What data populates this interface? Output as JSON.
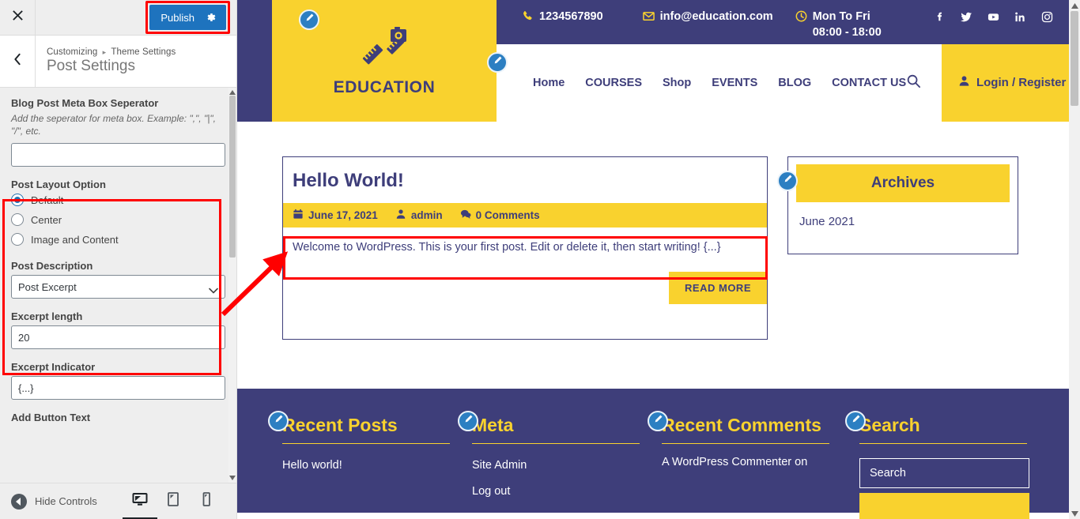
{
  "customizer": {
    "close_label": "Close",
    "publish_label": "Publish",
    "breadcrumb_root": "Customizing",
    "breadcrumb_sep": "▸",
    "breadcrumb_parent": "Theme Settings",
    "panel_title": "Post Settings",
    "hide_controls_label": "Hide Controls",
    "accent_blue": "#1E73BE",
    "highlight_red": "#ff0000",
    "controls": [
      {
        "type": "text",
        "label": "Blog Post Meta Box Seperator",
        "description": "Add the seperator for meta box. Example: \",\", \"|\", \"/\", etc.",
        "value": ""
      },
      {
        "type": "radio",
        "label": "Post Layout Option",
        "options": [
          {
            "label": "Default",
            "selected": true
          },
          {
            "label": "Center",
            "selected": false
          },
          {
            "label": "Image and Content",
            "selected": false
          }
        ]
      },
      {
        "type": "select",
        "label": "Post Description",
        "value": "Post Excerpt"
      },
      {
        "type": "text",
        "label": "Excerpt length",
        "value": "20"
      },
      {
        "type": "text",
        "label": "Excerpt Indicator",
        "value": "{...}"
      },
      {
        "type": "cutoff",
        "label": "Add Button Text"
      }
    ],
    "devices": [
      {
        "name": "desktop",
        "active": true
      },
      {
        "name": "tablet",
        "active": false
      },
      {
        "name": "mobile",
        "active": false
      }
    ]
  },
  "site": {
    "colors": {
      "navy": "#3E3E7A",
      "yellow": "#F9D22E"
    },
    "topbar": {
      "phone": "1234567890",
      "email": "info@education.com",
      "hours": "Mon To Fri 08:00 - 18:00",
      "socials": [
        "facebook",
        "twitter",
        "youtube",
        "linkedin",
        "instagram"
      ]
    },
    "logo_text": "EDUCATION",
    "nav": [
      "Home",
      "COURSES",
      "Shop",
      "EVENTS",
      "BLOG",
      "CONTACT US"
    ],
    "login_label": "Login / Register",
    "post": {
      "title": "Hello World!",
      "date": "June 17, 2021",
      "author": "admin",
      "comments": "0 Comments",
      "excerpt": "Welcome to WordPress. This is your first post. Edit or delete it, then start writing!",
      "excerpt_indicator": "{...}",
      "read_more": "READ MORE"
    },
    "archives_widget": {
      "title": "Archives",
      "items": [
        "June 2021"
      ]
    },
    "footer_widgets": [
      {
        "title": "Recent Posts",
        "items": [
          "Hello world!"
        ]
      },
      {
        "title": "Meta",
        "items": [
          "Site Admin",
          "Log out"
        ]
      },
      {
        "title": "Recent Comments",
        "items": [
          "A WordPress Commenter on"
        ]
      },
      {
        "title": "Search",
        "placeholder": "Search",
        "button_label": ""
      }
    ]
  }
}
